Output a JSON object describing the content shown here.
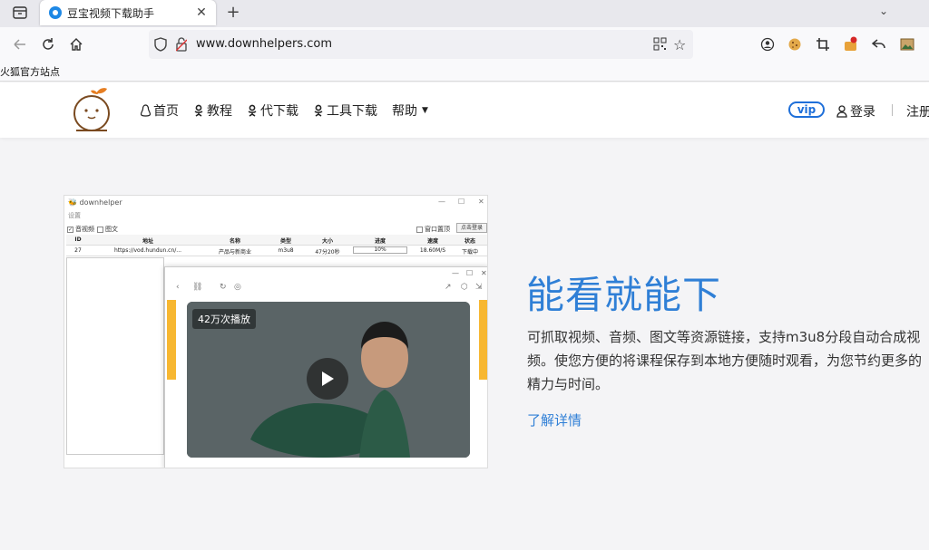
{
  "browser": {
    "tab": {
      "title": "豆宝视频下载助手",
      "close": "✕"
    },
    "new_tab": "+",
    "tabs_menu": "⌄",
    "url": {
      "host": "www.downhelpers.com"
    },
    "bookmarks": [
      "火狐官方站点"
    ],
    "icon_names": [
      "tab-list-icon",
      "back-icon",
      "reload-icon",
      "home-icon",
      "shield-icon",
      "lock-broken-icon",
      "qr-code-icon",
      "star-icon",
      "account-icon",
      "cookie-icon",
      "crop-icon",
      "extension-icon",
      "undo-icon",
      "picture-icon"
    ]
  },
  "site": {
    "menu": [
      {
        "label": "首页"
      },
      {
        "label": "教程"
      },
      {
        "label": "代下载"
      },
      {
        "label": "工具下载"
      },
      {
        "label": "帮助",
        "has_caret": true
      }
    ],
    "vip_label": "vip",
    "login_label": "登录",
    "register_label": "注册",
    "accent_color": "#2f7fd6"
  },
  "hero": {
    "title": "能看就能下",
    "description": "可抓取视频、音频、图文等资源链接，支持m3u8分段自动合成视频。使您方便的将课程保存到本地方便随时观看，为您节约更多的精力与时间。",
    "link": "了解详情"
  },
  "screenshot": {
    "app_title": "downhelper",
    "menu": "设置",
    "check_video": "音视频",
    "check_image": "图文",
    "check_top": "窗口置顶",
    "login_btn": "点击登录",
    "table_head": [
      "ID",
      "地址",
      "名称",
      "类型",
      "大小",
      "进度",
      "速度",
      "状态"
    ],
    "table_row": [
      "27",
      "https://vod.hundun.cn/...",
      "产品与新商业",
      "m3u8",
      "47分20秒",
      "10%",
      "18.60M/S",
      "下载中"
    ],
    "views": "42万次播放"
  }
}
